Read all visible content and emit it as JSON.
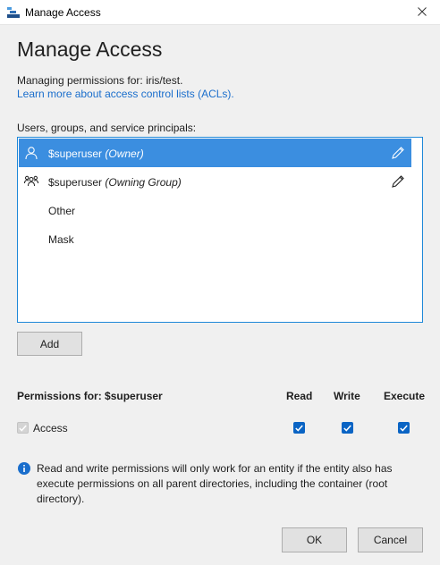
{
  "window": {
    "title": "Manage Access",
    "icon": "storage-explorer-icon"
  },
  "heading": "Manage Access",
  "managing_text": "Managing permissions for: iris/test.",
  "learn_link": "Learn more about access control lists (ACLs).",
  "list_label": "Users, groups, and service principals:",
  "principals": [
    {
      "name": "$superuser",
      "role": "(Owner)",
      "icon": "user-icon",
      "editable": true,
      "selected": true
    },
    {
      "name": "$superuser",
      "role": "(Owning Group)",
      "icon": "group-icon",
      "editable": true,
      "selected": false
    },
    {
      "name": "Other",
      "role": "",
      "icon": "",
      "editable": false,
      "selected": false
    },
    {
      "name": "Mask",
      "role": "",
      "icon": "",
      "editable": false,
      "selected": false
    }
  ],
  "add_label": "Add",
  "permissions": {
    "title": "Permissions for: $superuser",
    "columns": [
      "Read",
      "Write",
      "Execute"
    ],
    "row_label": "Access",
    "row_enabled": true,
    "values": {
      "read": true,
      "write": true,
      "execute": true
    }
  },
  "info_text": "Read and write permissions will only work for an entity if the entity also has execute permissions on all parent directories, including the container (root directory).",
  "ok_label": "OK",
  "cancel_label": "Cancel",
  "colors": {
    "accent": "#0a64c4",
    "selection": "#3b8ee0",
    "link": "#1a6ecc",
    "list_border": "#1e88d8"
  }
}
